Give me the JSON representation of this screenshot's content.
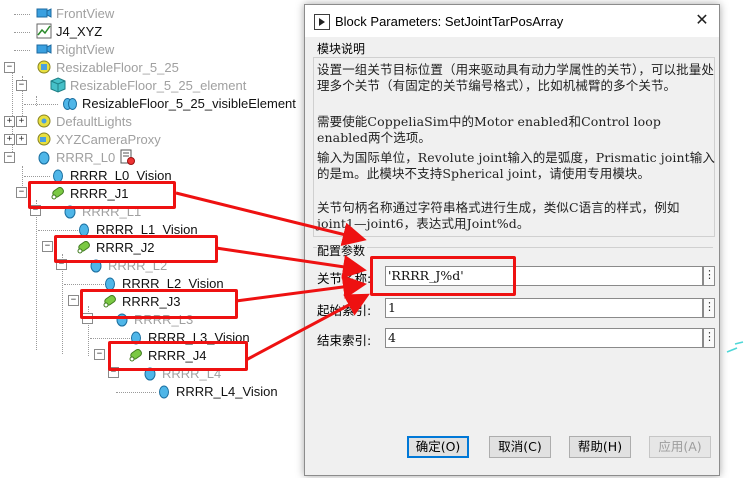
{
  "tree": {
    "items": [
      {
        "label": "FrontView",
        "style": "dim"
      },
      {
        "label": "J4_XYZ",
        "style": "dark"
      },
      {
        "label": "RightView",
        "style": "dim"
      },
      {
        "label": "ResizableFloor_5_25",
        "style": "dim"
      },
      {
        "label": "ResizableFloor_5_25_element",
        "style": "dim"
      },
      {
        "label": "ResizableFloor_5_25_visibleElement",
        "style": "dark"
      },
      {
        "label": "DefaultLights",
        "style": "dim"
      },
      {
        "label": "XYZCameraProxy",
        "style": "dim"
      },
      {
        "label": "RRRR_L0",
        "style": "dim"
      },
      {
        "label": "RRRR_L0_Vision",
        "style": "dark"
      },
      {
        "label": "RRRR_J1",
        "style": "dark"
      },
      {
        "label": "RRRR_L1",
        "style": "dim"
      },
      {
        "label": "RRRR_L1_Vision",
        "style": "dark"
      },
      {
        "label": "RRRR_J2",
        "style": "dark"
      },
      {
        "label": "RRRR_L2",
        "style": "dim"
      },
      {
        "label": "RRRR_L2_Vision",
        "style": "dark"
      },
      {
        "label": "RRRR_J3",
        "style": "dark"
      },
      {
        "label": "RRRR_L3",
        "style": "dim"
      },
      {
        "label": "RRRR_L3_Vision",
        "style": "dark"
      },
      {
        "label": "RRRR_J4",
        "style": "dark"
      },
      {
        "label": "RRRR_L4",
        "style": "dim"
      },
      {
        "label": "RRRR_L4_Vision",
        "style": "dark"
      }
    ]
  },
  "dialog": {
    "title": "Block Parameters: SetJointTarPosArray",
    "close": "✕",
    "section_header": "模块说明",
    "description": [
      "设置一组关节目标位置（用来驱动具有动力学属性的关节），可以批量处理多个关节（有固定的关节编号格式），比如机械臂的多个关节。",
      "需要使能CoppeliaSim中的Motor enabled和Control loop enabled两个选项。",
      "输入为国际单位，Revolute joint输入的是弧度，Prismatic joint输入的是m。此模块不支持Spherical joint，请使用专用模块。",
      "关节句柄名称通过字符串格式进行生成，类似C语言的样式，例如joint1—joint6，表达式用Joint%d。"
    ],
    "params_header": "配置参数",
    "params": [
      {
        "label": "关节名称:",
        "value": "'RRRR_J%d'"
      },
      {
        "label": "起始索引:",
        "value": "1"
      },
      {
        "label": "结束索引:",
        "value": "4"
      }
    ],
    "menu_glyph": "⋮",
    "buttons": {
      "ok": "确定(O)",
      "cancel": "取消(C)",
      "help": "帮助(H)",
      "apply": "应用(A)"
    }
  },
  "colors": {
    "highlight_box": "#ee1111",
    "arrow": "#ee1111",
    "joint_icon": "#7ac943",
    "shape_icon": "#4fb6e8"
  }
}
